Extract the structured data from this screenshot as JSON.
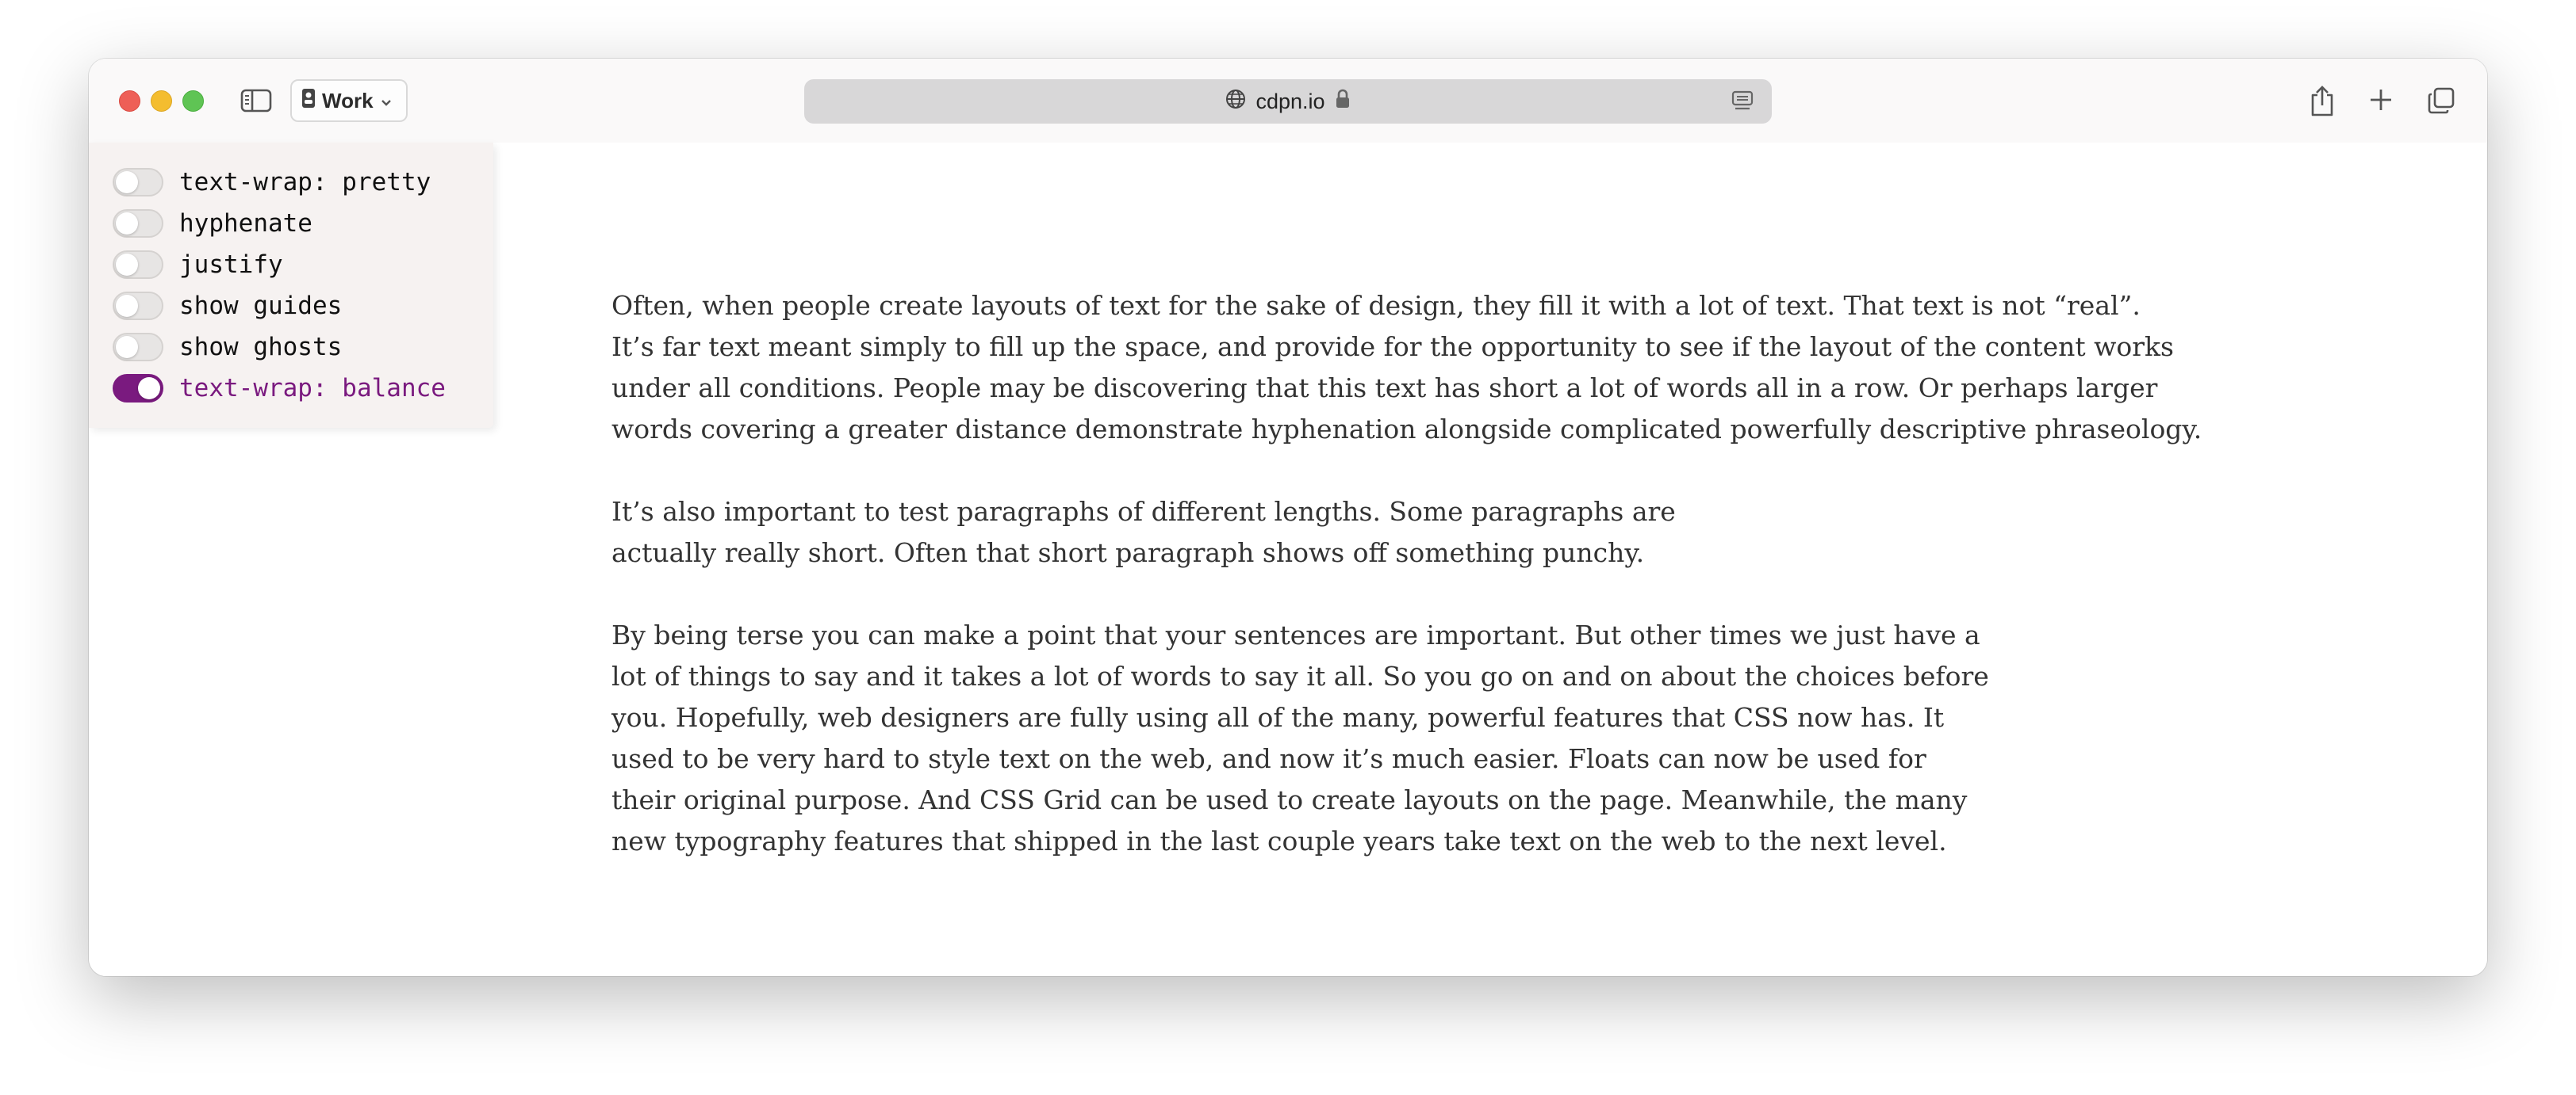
{
  "browser": {
    "profile_label": "Work",
    "url": "cdpn.io"
  },
  "controls": [
    {
      "label": "text-wrap: pretty",
      "on": false
    },
    {
      "label": "hyphenate",
      "on": false
    },
    {
      "label": "justify",
      "on": false
    },
    {
      "label": "show guides",
      "on": false
    },
    {
      "label": "show ghosts",
      "on": false
    },
    {
      "label": "text-wrap: balance",
      "on": true
    }
  ],
  "accent_color": "#7a1a7f",
  "article": {
    "paragraphs": [
      [
        "Often, when people create layouts of text for the sake of design, they fill it with a lot of text. That text is not “real”.",
        "It’s far text meant simply to fill up the space, and provide for the opportunity to see if the layout of the content works",
        "under all conditions. People may be discovering that this text has short a lot of words all in a row. Or perhaps larger",
        "words covering a greater distance demonstrate hyphenation alongside complicated powerfully descriptive phraseology."
      ],
      [
        "It’s also important to test paragraphs of different lengths. Some paragraphs are",
        "actually really short. Often that short paragraph shows off something punchy."
      ],
      [
        "By being terse you can make a point that your sentences are important. But other times we just have a",
        "lot of things to say and it takes a lot of words to say it all. So you go on and on about the choices before",
        "you. Hopefully, web designers are fully using all of the many, powerful features that CSS now has. It",
        "used to be very hard to style text on the web, and now it’s much easier. Floats can now be used for",
        "their original purpose. And CSS Grid can be used to create layouts on the page. Meanwhile, the many",
        "new typography features that shipped in the last couple years take text on the web to the next level."
      ]
    ]
  }
}
